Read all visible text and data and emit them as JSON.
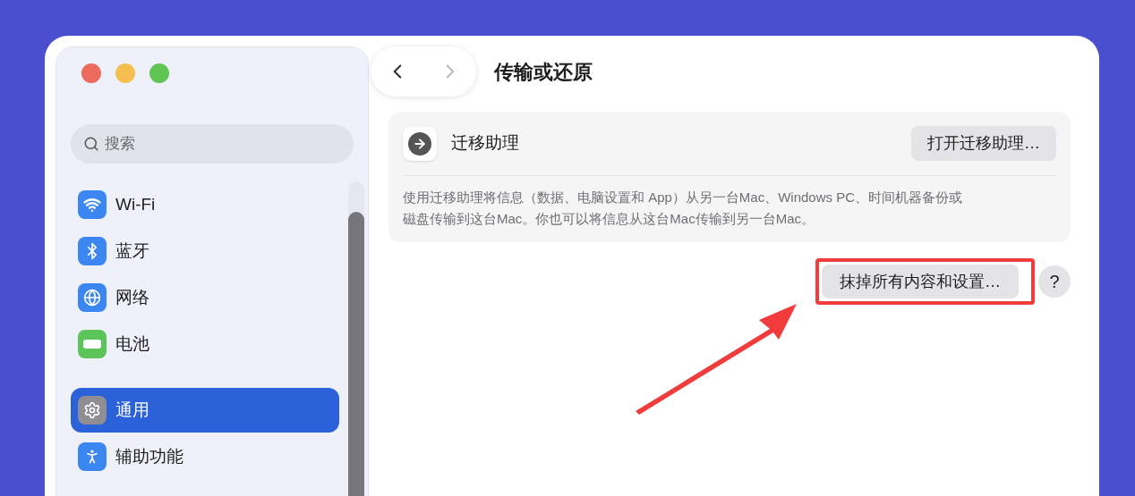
{
  "sidebar": {
    "search": {
      "placeholder": "搜索"
    },
    "groups": [
      [
        {
          "label": "Wi-Fi",
          "selected": false
        },
        {
          "label": "蓝牙",
          "selected": false
        },
        {
          "label": "网络",
          "selected": false
        },
        {
          "label": "电池",
          "selected": false
        }
      ],
      [
        {
          "label": "通用",
          "selected": true
        },
        {
          "label": "辅助功能",
          "selected": false
        }
      ]
    ]
  },
  "page": {
    "title": "传输或还原",
    "migration": {
      "name": "迁移助理",
      "button": "打开迁移助理…",
      "description": "使用迁移助理将信息（数据、电脑设置和 App）从另一台Mac、Windows PC、时间机器备份或磁盘传输到这台Mac。你也可以将信息从这台Mac传输到另一台Mac。"
    },
    "erase_button": "抹掉所有内容和设置…",
    "help_button": "?"
  }
}
